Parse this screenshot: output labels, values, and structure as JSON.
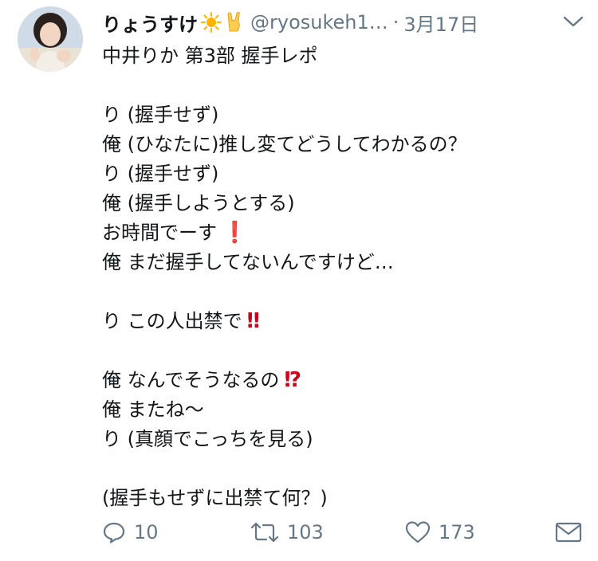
{
  "tweet": {
    "display_name": "りょうすけ",
    "name_emoji": "sun-emoji, rock-on-hand-emoji",
    "handle": "@ryosukeh1…",
    "separator": "·",
    "date": "3月17日",
    "lines": [
      "中井りか 第3部 握手レポ",
      "",
      "り (握手せず)",
      "俺 (ひなたに)推し変てどうしてわかるの？",
      "り (握手せず)",
      "俺 (握手しようとする)",
      "お時間でーす",
      "俺 まだ握手してないんですけど…",
      "",
      "り この人出禁で",
      "",
      "俺 なんでそうなるの",
      "俺 またね〜",
      "り (真顔でこっちを見る)",
      "",
      "(握手もせずに出禁て何？)"
    ],
    "line_marks": {
      "6": "❗",
      "9": "‼",
      "11": "⁉"
    },
    "reply_count": "10",
    "retweet_count": "103",
    "like_count": "173"
  },
  "colors": {
    "text": "#14171a",
    "secondary": "#657786",
    "emoji_red": "#d0021b",
    "sun": "#ffb300"
  },
  "icons": [
    "avatar-photo",
    "sun-emoji",
    "rock-on-hand-emoji",
    "chevron-down-icon",
    "reply-icon",
    "retweet-icon",
    "like-icon",
    "dm-icon"
  ]
}
